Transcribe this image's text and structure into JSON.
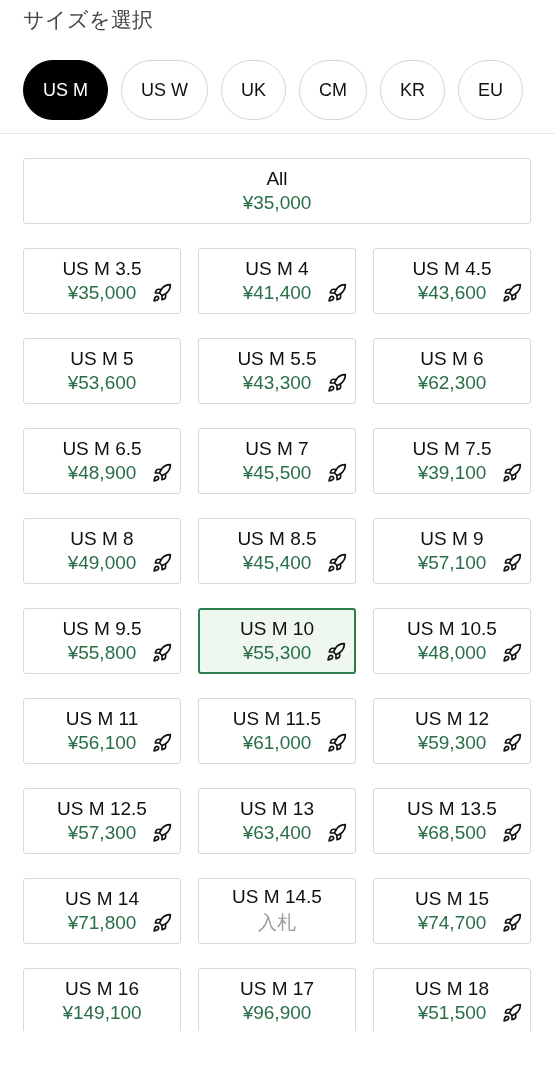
{
  "title": "サイズを選択",
  "tabs": [
    {
      "label": "US M",
      "selected": true
    },
    {
      "label": "US W",
      "selected": false
    },
    {
      "label": "UK",
      "selected": false
    },
    {
      "label": "CM",
      "selected": false
    },
    {
      "label": "KR",
      "selected": false
    },
    {
      "label": "EU",
      "selected": false
    }
  ],
  "all": {
    "label": "All",
    "price": "¥35,000"
  },
  "sizes": [
    {
      "label": "US M 3.5",
      "price": "¥35,000",
      "kind": "ask",
      "express": true,
      "selected": false
    },
    {
      "label": "US M 4",
      "price": "¥41,400",
      "kind": "ask",
      "express": true,
      "selected": false
    },
    {
      "label": "US M 4.5",
      "price": "¥43,600",
      "kind": "ask",
      "express": true,
      "selected": false
    },
    {
      "label": "US M 5",
      "price": "¥53,600",
      "kind": "ask",
      "express": false,
      "selected": false
    },
    {
      "label": "US M 5.5",
      "price": "¥43,300",
      "kind": "ask",
      "express": true,
      "selected": false
    },
    {
      "label": "US M 6",
      "price": "¥62,300",
      "kind": "ask",
      "express": false,
      "selected": false
    },
    {
      "label": "US M 6.5",
      "price": "¥48,900",
      "kind": "ask",
      "express": true,
      "selected": false
    },
    {
      "label": "US M 7",
      "price": "¥45,500",
      "kind": "ask",
      "express": true,
      "selected": false
    },
    {
      "label": "US M 7.5",
      "price": "¥39,100",
      "kind": "ask",
      "express": true,
      "selected": false
    },
    {
      "label": "US M 8",
      "price": "¥49,000",
      "kind": "ask",
      "express": true,
      "selected": false
    },
    {
      "label": "US M 8.5",
      "price": "¥45,400",
      "kind": "ask",
      "express": true,
      "selected": false
    },
    {
      "label": "US M 9",
      "price": "¥57,100",
      "kind": "ask",
      "express": true,
      "selected": false
    },
    {
      "label": "US M 9.5",
      "price": "¥55,800",
      "kind": "ask",
      "express": true,
      "selected": false
    },
    {
      "label": "US M 10",
      "price": "¥55,300",
      "kind": "ask",
      "express": true,
      "selected": true
    },
    {
      "label": "US M 10.5",
      "price": "¥48,000",
      "kind": "ask",
      "express": true,
      "selected": false
    },
    {
      "label": "US M 11",
      "price": "¥56,100",
      "kind": "ask",
      "express": true,
      "selected": false
    },
    {
      "label": "US M 11.5",
      "price": "¥61,000",
      "kind": "ask",
      "express": true,
      "selected": false
    },
    {
      "label": "US M 12",
      "price": "¥59,300",
      "kind": "ask",
      "express": true,
      "selected": false
    },
    {
      "label": "US M 12.5",
      "price": "¥57,300",
      "kind": "ask",
      "express": true,
      "selected": false
    },
    {
      "label": "US M 13",
      "price": "¥63,400",
      "kind": "ask",
      "express": true,
      "selected": false
    },
    {
      "label": "US M 13.5",
      "price": "¥68,500",
      "kind": "ask",
      "express": true,
      "selected": false
    },
    {
      "label": "US M 14",
      "price": "¥71,800",
      "kind": "ask",
      "express": true,
      "selected": false
    },
    {
      "label": "US M 14.5",
      "price": "入札",
      "kind": "bid",
      "express": false,
      "selected": false
    },
    {
      "label": "US M 15",
      "price": "¥74,700",
      "kind": "ask",
      "express": true,
      "selected": false
    },
    {
      "label": "US M 16",
      "price": "¥149,100",
      "kind": "ask",
      "express": false,
      "selected": false
    },
    {
      "label": "US M 17",
      "price": "¥96,900",
      "kind": "ask",
      "express": false,
      "selected": false
    },
    {
      "label": "US M 18",
      "price": "¥51,500",
      "kind": "ask",
      "express": true,
      "selected": false
    }
  ]
}
